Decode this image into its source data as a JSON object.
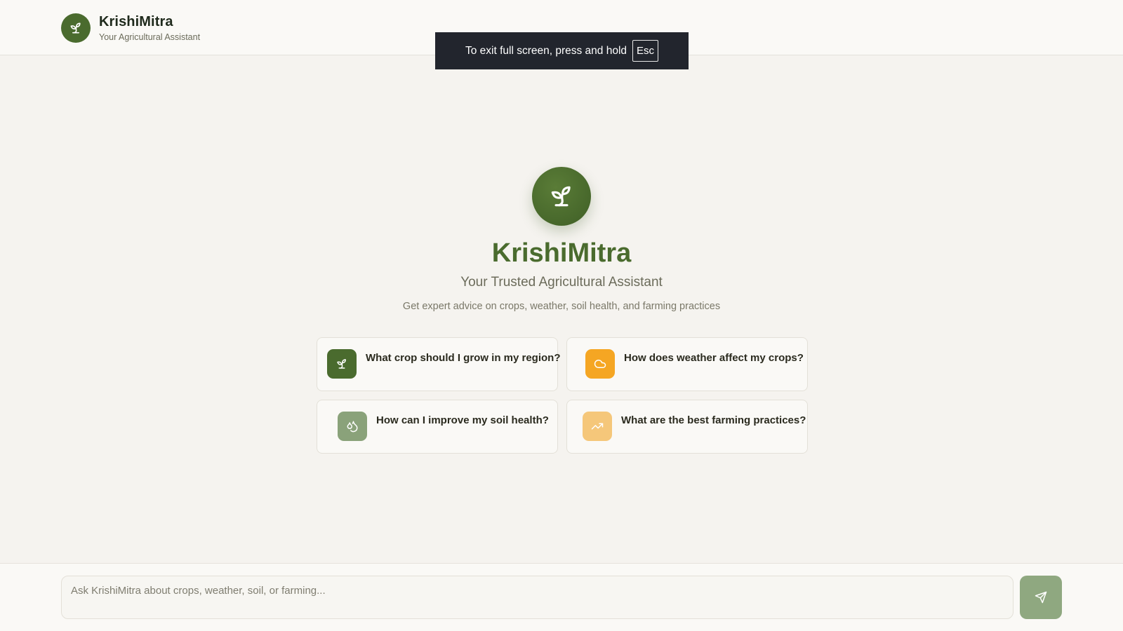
{
  "header": {
    "brand_name": "KrishiMitra",
    "brand_subtitle": "Your Agricultural Assistant",
    "logo_icon": "sprout-icon"
  },
  "fullscreen_notice": {
    "text": "To exit full screen, press and hold",
    "key": "Esc"
  },
  "hero": {
    "icon": "sprout-icon",
    "title": "KrishiMitra",
    "subtitle": "Your Trusted Agricultural Assistant",
    "description": "Get expert advice on crops, weather, soil health, and farming practices"
  },
  "suggestions": [
    {
      "label": "What crop should I grow in my region?",
      "icon": "sprout-icon",
      "color": "#4a6b2e"
    },
    {
      "label": "How does weather affect my crops?",
      "icon": "cloud-icon",
      "color": "#f5a623"
    },
    {
      "label": "How can I improve my soil health?",
      "icon": "droplets-icon",
      "color": "#8aa27a"
    },
    {
      "label": "What are the best farming practices?",
      "icon": "trending-up-icon",
      "color": "#f5c77a"
    }
  ],
  "composer": {
    "placeholder": "Ask KrishiMitra about crops, weather, soil, or farming...",
    "send_icon": "send-icon"
  },
  "colors": {
    "brand_green": "#4a6b2e",
    "background": "#f5f3ef",
    "send_button": "#8fa880"
  }
}
